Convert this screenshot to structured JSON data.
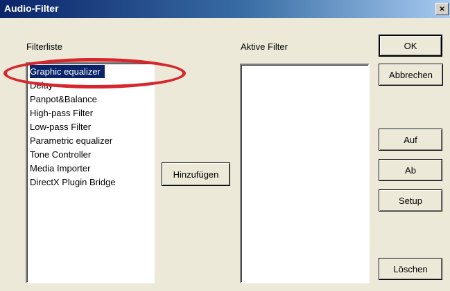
{
  "window": {
    "title": "Audio-Filter",
    "close_glyph": "×"
  },
  "filter_list": {
    "label": "Filterliste",
    "items": [
      "Graphic equalizer",
      "Delay",
      "Panpot&Balance",
      "High-pass Filter",
      "Low-pass Filter",
      "Parametric equalizer",
      "Tone Controller",
      "Media Importer",
      "DirectX Plugin Bridge"
    ],
    "selected_index": 0
  },
  "active_filter": {
    "label": "Aktive Filter",
    "items": []
  },
  "buttons": {
    "ok": "OK",
    "cancel": "Abbrechen",
    "add": "Hinzufügen",
    "up": "Auf",
    "down": "Ab",
    "setup": "Setup",
    "delete": "Löschen"
  },
  "colors": {
    "selection": "#0a246a",
    "annotation_ring": "#d7262c",
    "dialog_face": "#ece9d8"
  },
  "annotation": {
    "type": "ellipse-highlight",
    "target": "Graphic equalizer"
  }
}
